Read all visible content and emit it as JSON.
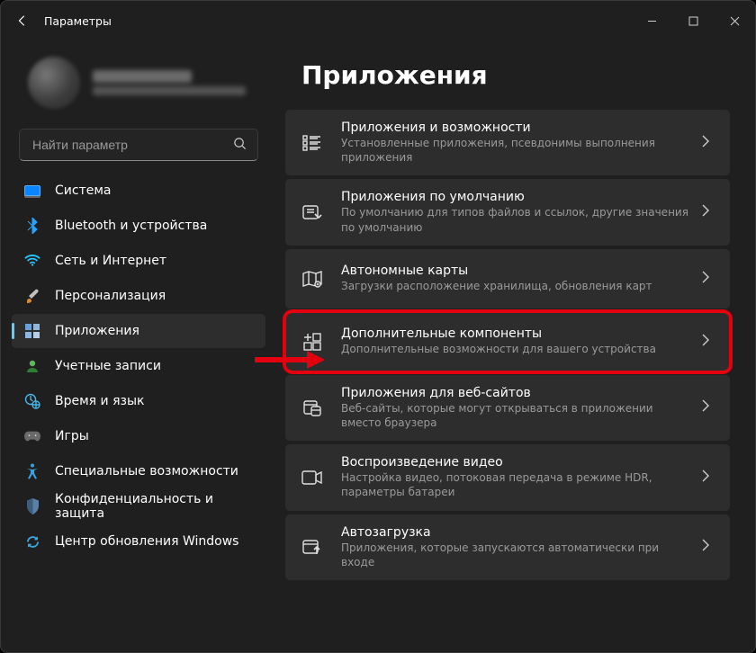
{
  "window": {
    "title": "Параметры"
  },
  "search": {
    "placeholder": "Найти параметр"
  },
  "sidebar": {
    "items": [
      {
        "label": "Система"
      },
      {
        "label": "Bluetooth и устройства"
      },
      {
        "label": "Сеть и Интернет"
      },
      {
        "label": "Персонализация"
      },
      {
        "label": "Приложения"
      },
      {
        "label": "Учетные записи"
      },
      {
        "label": "Время и язык"
      },
      {
        "label": "Игры"
      },
      {
        "label": "Специальные возможности"
      },
      {
        "label": "Конфиденциальность и защита"
      },
      {
        "label": "Центр обновления Windows"
      }
    ]
  },
  "main": {
    "heading": "Приложения",
    "cards": [
      {
        "title": "Приложения и возможности",
        "sub": "Установленные приложения, псевдонимы выполнения приложения"
      },
      {
        "title": "Приложения по умолчанию",
        "sub": "По умолчанию для типов файлов и ссылок, другие значения по умолчанию"
      },
      {
        "title": "Автономные карты",
        "sub": "Загрузки расположение хранилища, обновления карт"
      },
      {
        "title": "Дополнительные компоненты",
        "sub": "Дополнительные возможности для вашего устройства"
      },
      {
        "title": "Приложения для веб-сайтов",
        "sub": "Веб-сайты, которые могут открываться в приложении вместо браузера"
      },
      {
        "title": "Воспроизведение видео",
        "sub": "Настройка видео, потоковая передача в режиме HDR, параметры батареи"
      },
      {
        "title": "Автозагрузка",
        "sub": "Приложения, которые запускаются автоматически при входе"
      }
    ]
  },
  "highlight": {
    "sidebar_index": 4,
    "card_index": 3
  }
}
